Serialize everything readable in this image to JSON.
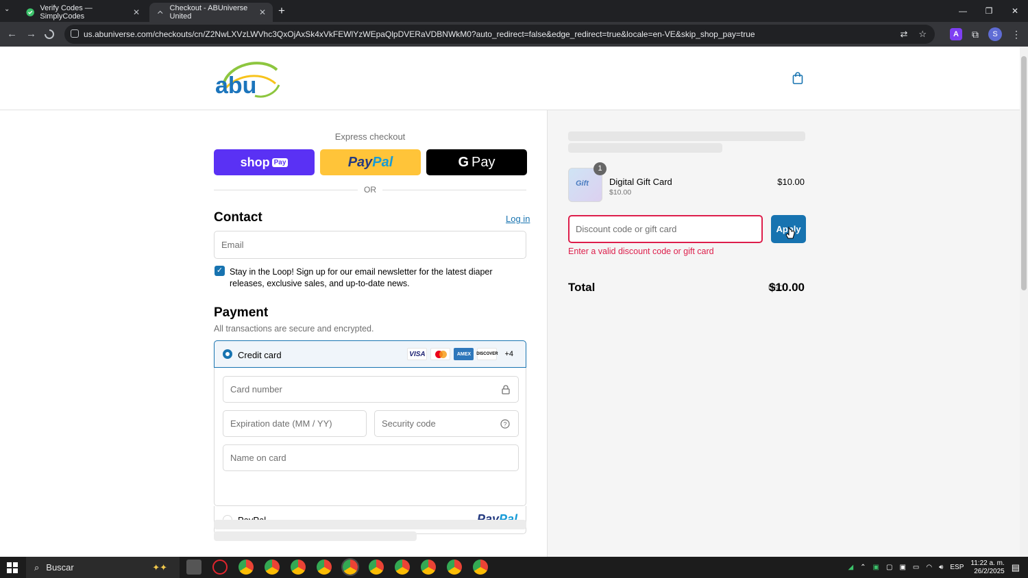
{
  "browser": {
    "tabs": [
      {
        "title": "Verify Codes — SimplyCodes",
        "icon": "simplycodes-icon",
        "active": false
      },
      {
        "title": "Checkout - ABUniverse United",
        "icon": "loading-icon",
        "active": true
      }
    ],
    "url": "us.abuniverse.com/checkouts/cn/Z2NwLXVzLWVhc3QxOjAxSk4xVkFEWlYzWEpaQlpDVERaVDBNWkM0?auto_redirect=false&edge_redirect=true&locale=en-VE&skip_shop_pay=true",
    "profile_initial": "S",
    "extension_label": "A"
  },
  "header": {
    "logo_text": "abu"
  },
  "express": {
    "title": "Express checkout",
    "shop_pay": "shop",
    "shop_pay_badge": "Pay",
    "paypal_a": "Pay",
    "paypal_b": "Pal",
    "gpay_g": "G",
    "gpay_label": "Pay",
    "or": "OR"
  },
  "contact": {
    "title": "Contact",
    "login": "Log in",
    "email_placeholder": "Email",
    "newsletter_checked": true,
    "newsletter_text": "Stay in the Loop! Sign up for our email newsletter for the latest diaper releases, exclusive sales, and up-to-date news."
  },
  "payment": {
    "title": "Payment",
    "subtitle": "All transactions are secure and encrypted.",
    "credit_card_label": "Credit card",
    "card_brands": [
      "VISA",
      "mastercard",
      "AMEX",
      "DISCOVER"
    ],
    "more_cards": "+4",
    "card_number": "Card number",
    "expiration": "Expiration date (MM / YY)",
    "security_code": "Security code",
    "name_on_card": "Name on card",
    "paypal_label": "PayPal",
    "paypal_logo_a": "Pay",
    "paypal_logo_b": "Pal"
  },
  "summary": {
    "item": {
      "name": "Digital Gift Card",
      "sub_price": "$10.00",
      "price": "$10.00",
      "quantity": "1",
      "thumb_text": "Gift"
    },
    "discount_placeholder": "Discount code or gift card",
    "apply": "Apply",
    "error": "Enter a valid discount code or gift card",
    "total_label": "Total",
    "currency": "USD",
    "total": "$10.00"
  },
  "taskbar": {
    "search": "Buscar",
    "language": "ESP",
    "time": "11:22 a. m.",
    "date": "26/2/2025"
  },
  "colors": {
    "accent": "#1773b0",
    "error": "#dd1d4a",
    "shop_pay": "#5a31f4",
    "paypal": "#ffc439"
  }
}
